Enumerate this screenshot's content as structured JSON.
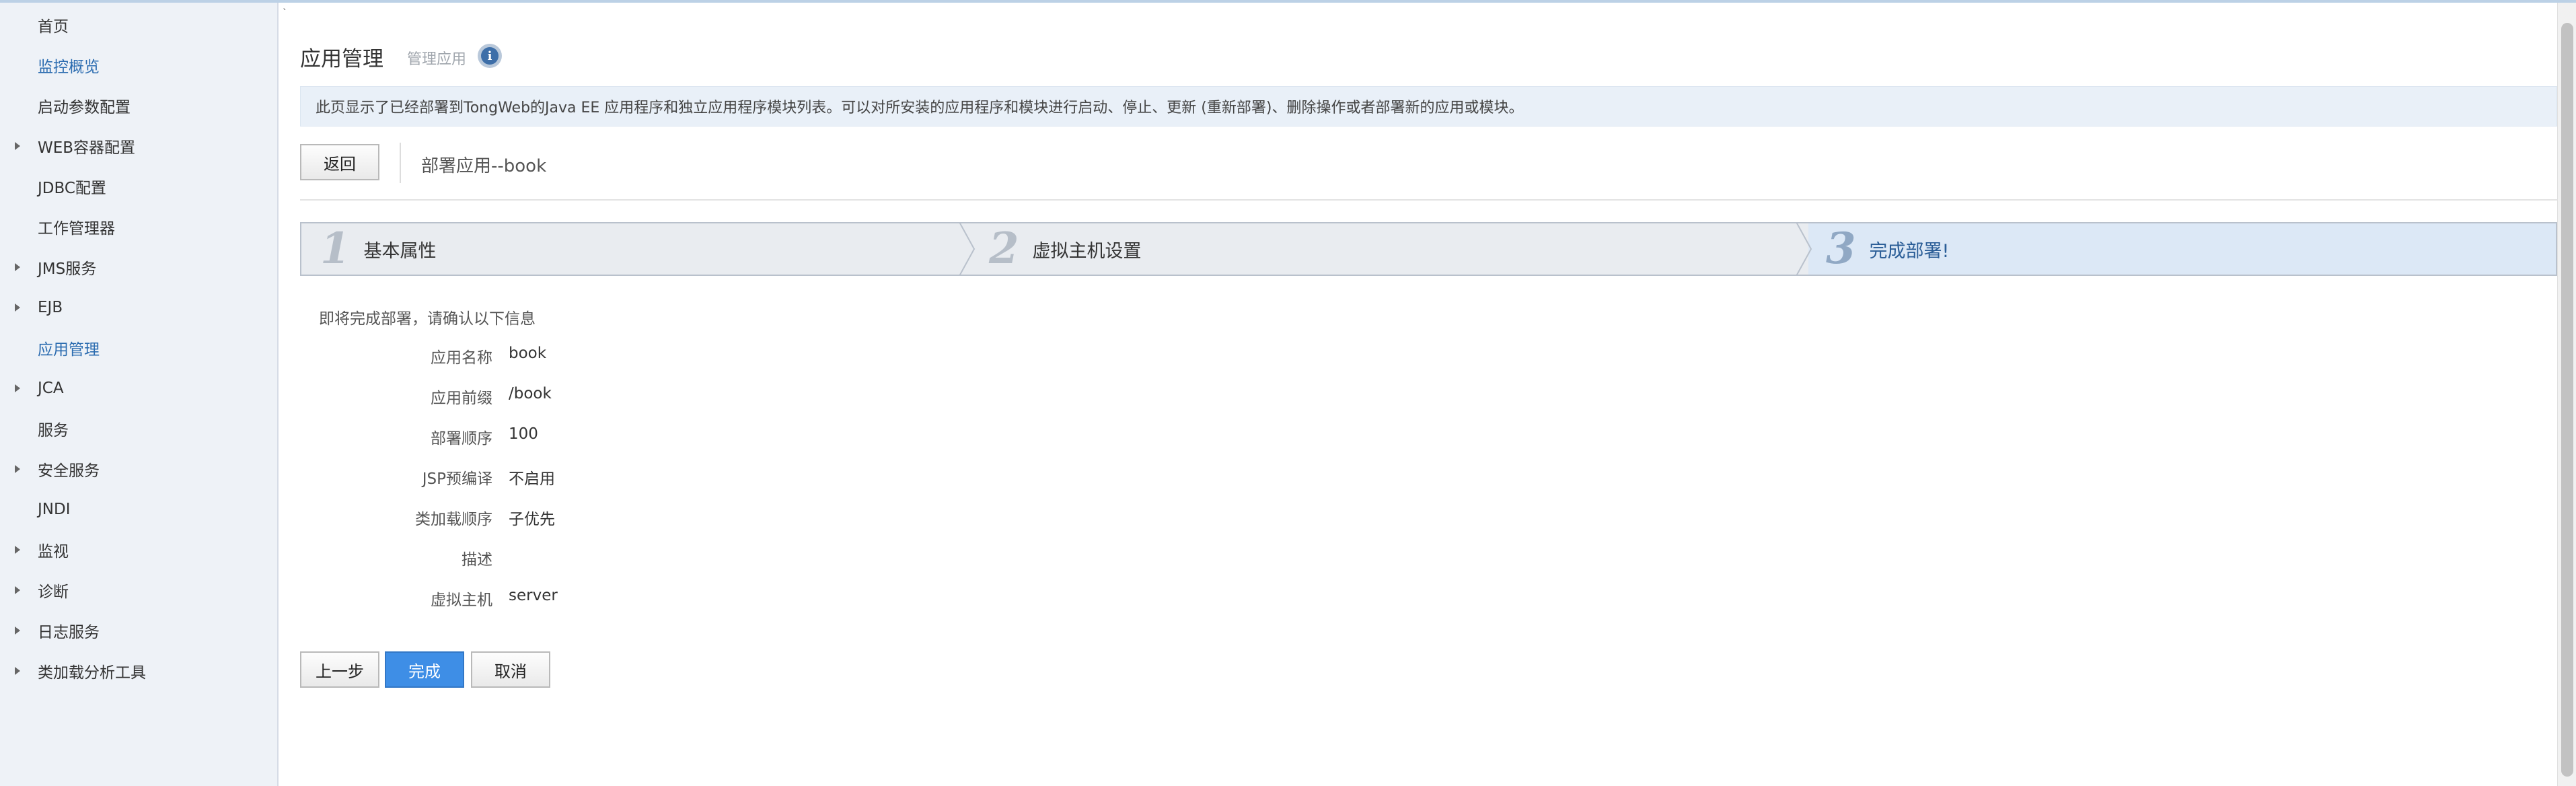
{
  "sidebar": {
    "items": [
      {
        "label": "首页",
        "arrow": false,
        "active": false
      },
      {
        "label": "监控概览",
        "arrow": false,
        "active": true
      },
      {
        "label": "启动参数配置",
        "arrow": false,
        "active": false
      },
      {
        "label": "WEB容器配置",
        "arrow": true,
        "active": false
      },
      {
        "label": "JDBC配置",
        "arrow": false,
        "active": false
      },
      {
        "label": "工作管理器",
        "arrow": false,
        "active": false
      },
      {
        "label": "JMS服务",
        "arrow": true,
        "active": false
      },
      {
        "label": "EJB",
        "arrow": true,
        "active": false
      },
      {
        "label": "应用管理",
        "arrow": false,
        "active": true
      },
      {
        "label": "JCA",
        "arrow": true,
        "active": false
      },
      {
        "label": "服务",
        "arrow": false,
        "active": false
      },
      {
        "label": "安全服务",
        "arrow": true,
        "active": false
      },
      {
        "label": "JNDI",
        "arrow": false,
        "active": false
      },
      {
        "label": "监视",
        "arrow": true,
        "active": false
      },
      {
        "label": "诊断",
        "arrow": true,
        "active": false
      },
      {
        "label": "日志服务",
        "arrow": true,
        "active": false
      },
      {
        "label": "类加载分析工具",
        "arrow": true,
        "active": false
      }
    ]
  },
  "header": {
    "tick": "`",
    "title": "应用管理",
    "subtitle": "管理应用",
    "info_icon": "i"
  },
  "description": "此页显示了已经部署到TongWeb的Java EE 应用程序和独立应用程序模块列表。可以对所安装的应用程序和模块进行启动、停止、更新 (重新部署)、删除操作或者部署新的应用或模块。",
  "toolbar": {
    "back_label": "返回",
    "deploy_title": "部署应用--book"
  },
  "steps": [
    {
      "num": "1",
      "label": "基本属性",
      "active": false
    },
    {
      "num": "2",
      "label": "虚拟主机设置",
      "active": false
    },
    {
      "num": "3",
      "label": "完成部署!",
      "active": true
    }
  ],
  "confirm": {
    "intro": "即将完成部署，请确认以下信息",
    "rows": [
      {
        "key": "应用名称",
        "value": "book"
      },
      {
        "key": "应用前缀",
        "value": "/book"
      },
      {
        "key": "部署顺序",
        "value": "100"
      },
      {
        "key": "JSP预编译",
        "value": "不启用"
      },
      {
        "key": "类加载顺序",
        "value": "子优先"
      },
      {
        "key": "描述",
        "value": ""
      },
      {
        "key": "虚拟主机",
        "value": "server"
      }
    ]
  },
  "actions": {
    "prev_label": "上一步",
    "finish_label": "完成",
    "cancel_label": "取消"
  },
  "colors": {
    "accent": "#3e8ee6",
    "active_link": "#2b6cb0",
    "sidebar_bg": "#eef2f7"
  }
}
